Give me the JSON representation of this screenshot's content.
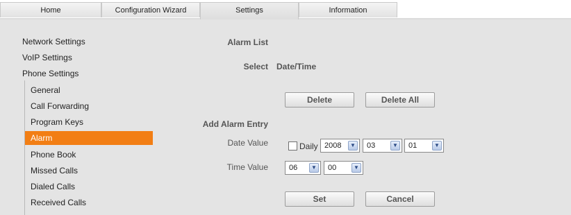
{
  "tabs": [
    "Home",
    "Configuration Wizard",
    "Settings",
    "Information"
  ],
  "active_tab": "Settings",
  "sidebar": {
    "top_items": [
      "Network Settings",
      "VoIP Settings",
      "Phone Settings"
    ],
    "sub_items": [
      "General",
      "Call Forwarding",
      "Program Keys",
      "Alarm",
      "Phone Book",
      "Missed Calls",
      "Dialed Calls",
      "Received Calls"
    ],
    "active_item": "Alarm"
  },
  "alarm_list": {
    "heading": "Alarm List",
    "select_label": "Select",
    "datetime_header": "Date/Time",
    "delete_label": "Delete",
    "delete_all_label": "Delete All"
  },
  "add_entry": {
    "heading": "Add Alarm Entry",
    "date_label": "Date Value",
    "daily_label": "Daily",
    "daily_checked": false,
    "year": "2008",
    "month": "03",
    "day": "01",
    "time_label": "Time Value",
    "hour": "06",
    "minute": "00",
    "set_label": "Set",
    "cancel_label": "Cancel"
  },
  "colors": {
    "accent": "#f27e14",
    "panel": "#e4e4e4"
  }
}
